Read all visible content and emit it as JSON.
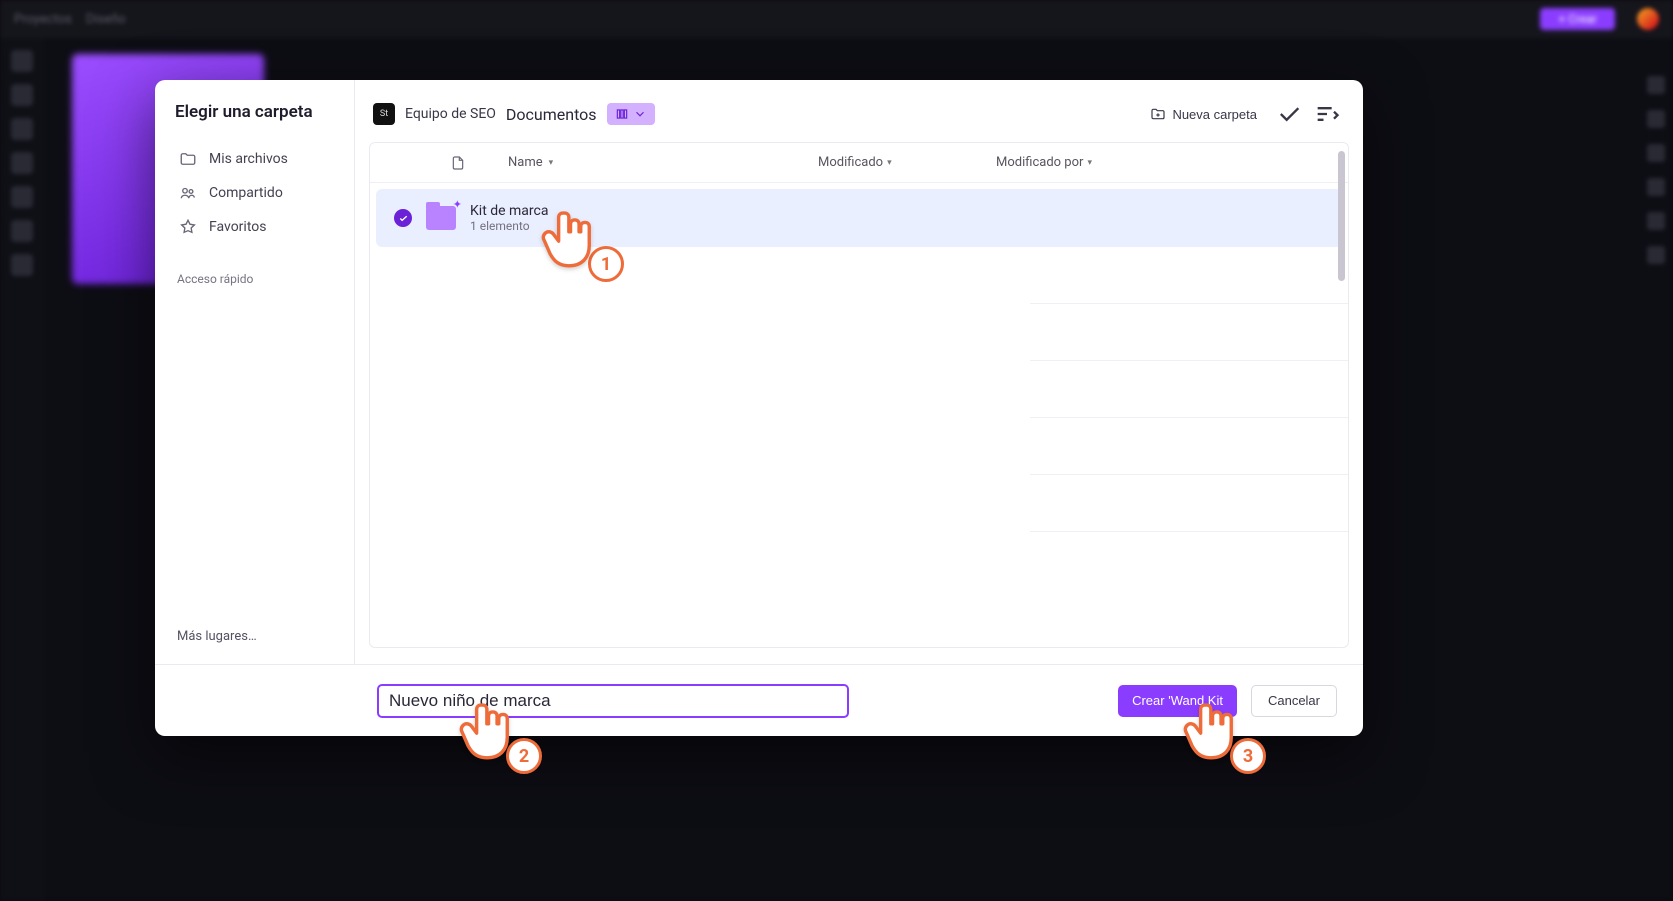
{
  "bg": {
    "title1": "Proyectos",
    "title2": "Diseño",
    "create": "+ Crear"
  },
  "sidebar": {
    "title": "Elegir una carpeta",
    "items": [
      {
        "label": "Mis archivos",
        "icon": "folder-icon"
      },
      {
        "label": "Compartido",
        "icon": "people-icon"
      },
      {
        "label": "Favoritos",
        "icon": "star-icon"
      }
    ],
    "quick_label": "Acceso rápido",
    "more_places": "Más lugares…"
  },
  "path": {
    "badge": "St",
    "team": "Equipo de SEO",
    "section": "Documentos",
    "new_folder": "Nueva carpeta"
  },
  "columns": {
    "name": "Name",
    "modified": "Modificado",
    "modified_by": "Modificado por"
  },
  "rows": [
    {
      "name": "Kit de marca",
      "subtitle": "1 elemento",
      "selected": true
    }
  ],
  "footer": {
    "input_value": "Nuevo niño de marca",
    "primary": "Crear 'Wand Kit",
    "secondary": "Cancelar"
  },
  "annotations": {
    "p1": "1",
    "p2": "2",
    "p3": "3"
  }
}
